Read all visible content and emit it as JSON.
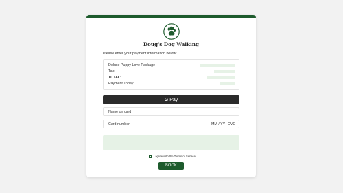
{
  "business": {
    "name": "Doug's Dog Walking",
    "logo_icon": "paw-print-icon"
  },
  "instructions": "Please enter your payment information below:",
  "summary": {
    "rows": [
      {
        "label": "Deluxe Puppy Love Package"
      },
      {
        "label": "Tax:"
      },
      {
        "label": "TOTAL:"
      },
      {
        "label": "Payment Today:"
      }
    ]
  },
  "gpay": {
    "g_letter": "G",
    "label": "Pay"
  },
  "fields": {
    "name_placeholder": "Name on card",
    "card_number_placeholder": "Card number",
    "expiry_placeholder": "MM / YY",
    "cvc_placeholder": "CVC"
  },
  "terms_label": "I agree with the Terms of Service",
  "book_label": "BOOK",
  "colors": {
    "brand_green": "#1e5b2d",
    "light_green": "#e6f2e6",
    "gpay_black": "#2b2b2b"
  }
}
